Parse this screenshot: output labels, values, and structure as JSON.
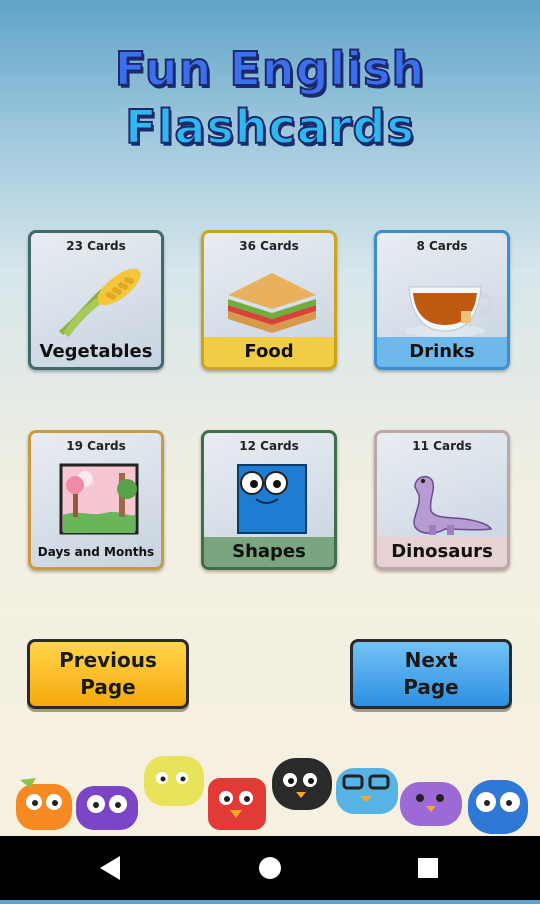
{
  "title": {
    "line1": "Fun English",
    "line2": "Flashcards"
  },
  "cards": [
    {
      "count": "23 Cards",
      "label": "Vegetables",
      "border": "#3e6a6a",
      "labelBg": ""
    },
    {
      "count": "36 Cards",
      "label": "Food",
      "border": "#caa51a",
      "labelBg": "#f2cd44"
    },
    {
      "count": "8 Cards",
      "label": "Drinks",
      "border": "#3b8ecf",
      "labelBg": "#6fb8ec"
    },
    {
      "count": "19 Cards",
      "label": "Days and Months",
      "border": "#c89b40",
      "labelBg": ""
    },
    {
      "count": "12 Cards",
      "label": "Shapes",
      "border": "#3e6f46",
      "labelBg": "#7aa57f"
    },
    {
      "count": "11 Cards",
      "label": "Dinosaurs",
      "border": "#c0a5a6",
      "labelBg": "#e7d3d3"
    }
  ],
  "buttons": {
    "prev_line1": "Previous",
    "prev_line2": "Page",
    "next_line1": "Next",
    "next_line2": "Page"
  },
  "navbar": {
    "back": "back-icon",
    "home": "home-icon",
    "recents": "recents-icon"
  }
}
